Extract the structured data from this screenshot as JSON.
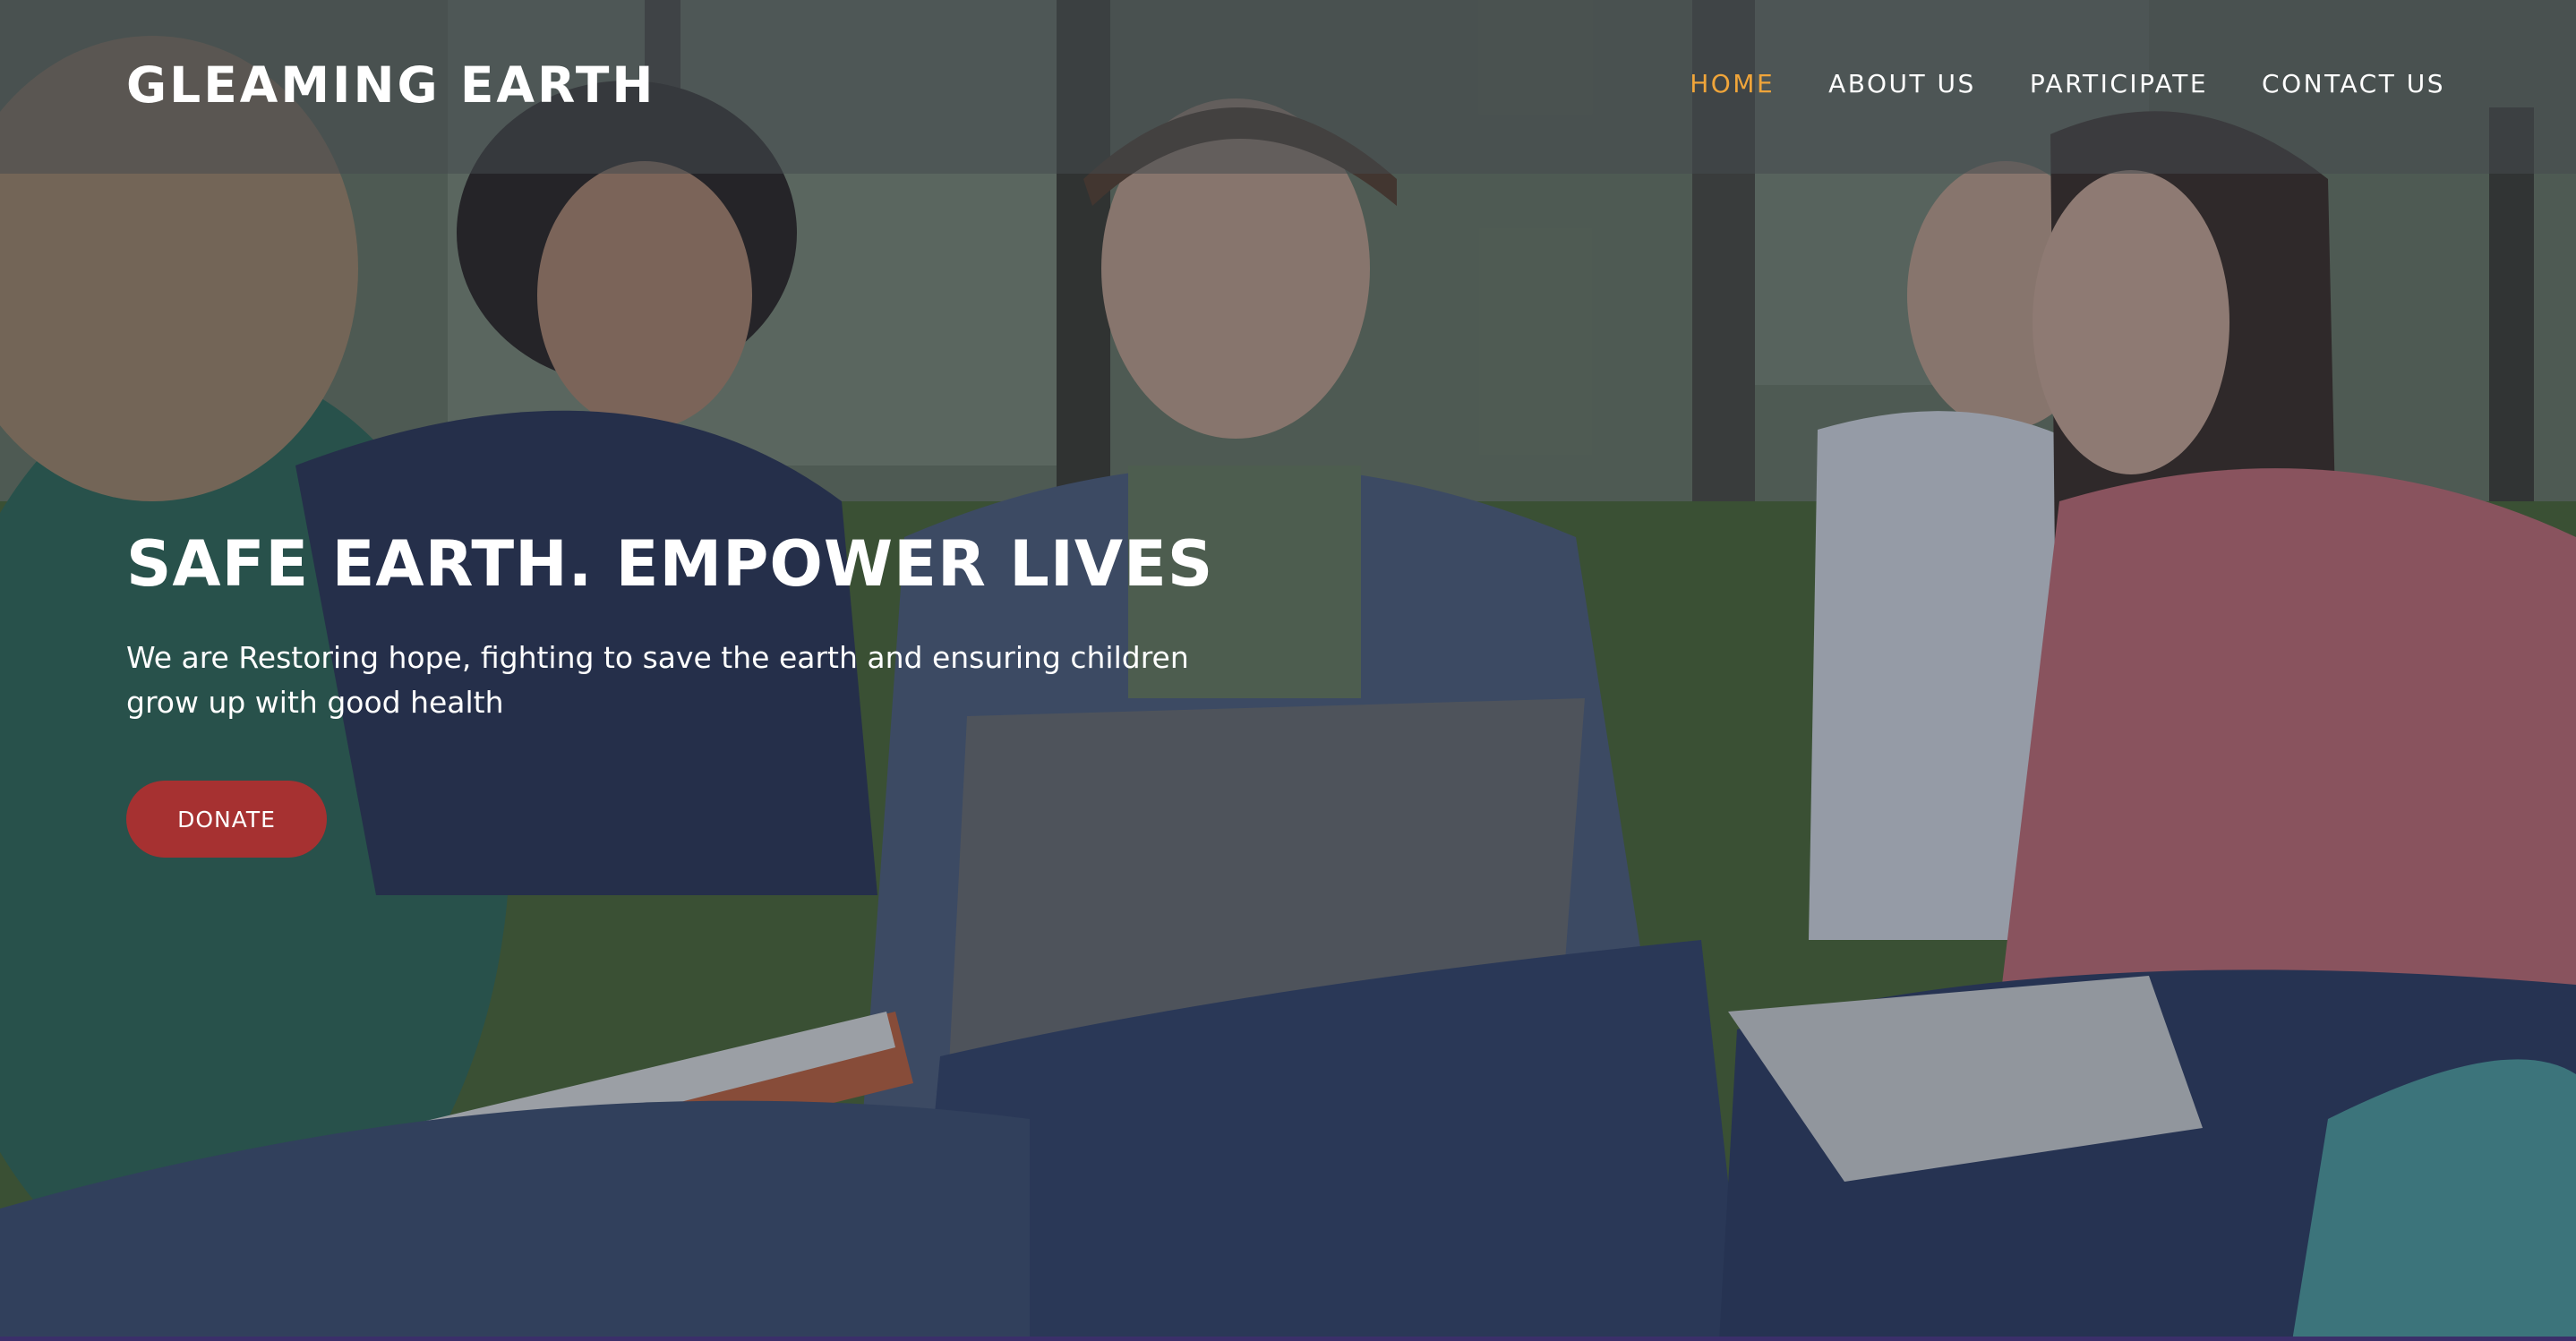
{
  "brand": {
    "name": "GLEAMING EARTH"
  },
  "nav": {
    "items": [
      {
        "label": "HOME",
        "active": true
      },
      {
        "label": "ABOUT US",
        "active": false
      },
      {
        "label": "PARTICIPATE",
        "active": false
      },
      {
        "label": "CONTACT US",
        "active": false
      }
    ],
    "active_color": "#f0a53a"
  },
  "hero": {
    "headline": "SAFE EARTH. EMPOWER LIVES",
    "subtext": "We are Restoring hope, fighting to save the earth and ensuring children grow up with good health",
    "cta_label": "DONATE",
    "cta_color": "#a63131",
    "background_image": "students sitting on grass in a park with a laptop and books"
  }
}
